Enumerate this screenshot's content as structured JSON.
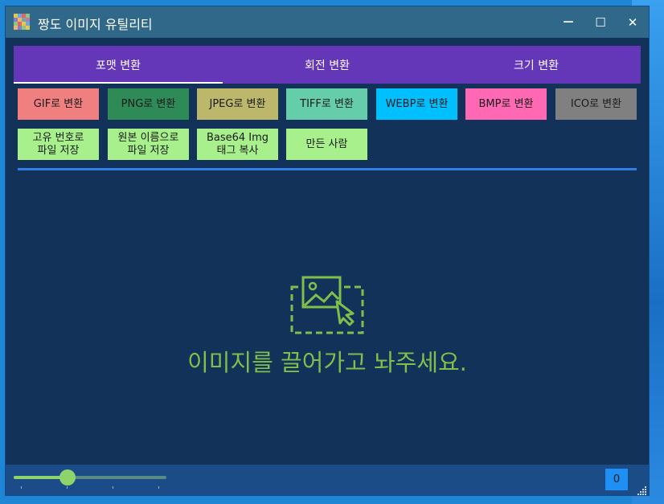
{
  "window": {
    "title": "짱도 이미지 유틸리티",
    "minimize_glyph": "—",
    "maximize_glyph": "☐",
    "close_glyph": "✕",
    "icon": "mosaic-app-icon"
  },
  "tabs": [
    {
      "label": "포맷 변환",
      "active": true
    },
    {
      "label": "회전 변환",
      "active": false
    },
    {
      "label": "크기 변환",
      "active": false
    }
  ],
  "format_buttons": [
    {
      "label": "GIF로 변환",
      "color": "#f08080"
    },
    {
      "label": "PNG로 변환",
      "color": "#2e8b57"
    },
    {
      "label": "JPEG로 변환",
      "color": "#bdb76b"
    },
    {
      "label": "TIFF로 변환",
      "color": "#66cdaa"
    },
    {
      "label": "WEBP로 변환",
      "color": "#00bfff"
    },
    {
      "label": "BMP로 변환",
      "color": "#ff69b4"
    },
    {
      "label": "ICO로 변환",
      "color": "#808080"
    }
  ],
  "action_buttons": [
    {
      "line1": "고유 번호로",
      "line2": "파일 저장",
      "color": "#a8f08c"
    },
    {
      "line1": "원본 이름으로",
      "line2": "파일 저장",
      "color": "#a8f08c"
    },
    {
      "line1": "Base64 Img",
      "line2": "태그 복사",
      "color": "#a8f08c"
    },
    {
      "line1": "만든 사람",
      "line2": "",
      "color": "#a8f08c"
    }
  ],
  "drop_zone": {
    "icon": "image-drop-icon",
    "message": "이미지를 끌어가고 놔주세요.",
    "color": "#7fbf4a"
  },
  "status": {
    "slider_value_fraction": 0.35,
    "counter": "0"
  },
  "colors": {
    "background": "#12325a",
    "titlebar": "#2f6888",
    "tabbar": "#6437b8",
    "accent": "#2f7fe6",
    "statusbar": "#1c4c88"
  }
}
